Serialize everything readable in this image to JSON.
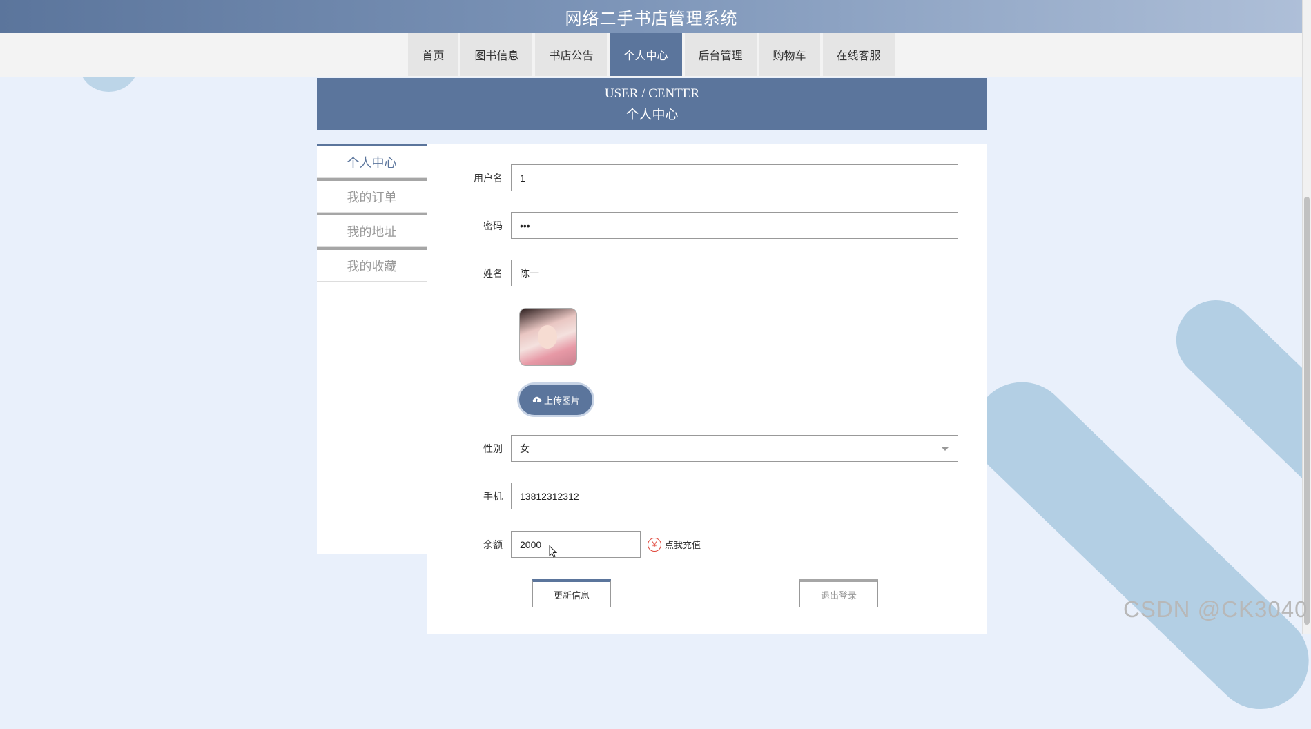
{
  "header": {
    "title": "网络二手书店管理系统"
  },
  "nav": {
    "items": [
      {
        "label": "首页"
      },
      {
        "label": "图书信息"
      },
      {
        "label": "书店公告"
      },
      {
        "label": "个人中心"
      },
      {
        "label": "后台管理"
      },
      {
        "label": "购物车"
      },
      {
        "label": "在线客服"
      }
    ],
    "active": "个人中心"
  },
  "banner": {
    "en": "USER / CENTER",
    "cn": "个人中心"
  },
  "side_menu": {
    "items": [
      {
        "label": "个人中心"
      },
      {
        "label": "我的订单"
      },
      {
        "label": "我的地址"
      },
      {
        "label": "我的收藏"
      }
    ],
    "active": "个人中心"
  },
  "form": {
    "username": {
      "label": "用户名",
      "value": "1"
    },
    "password": {
      "label": "密码",
      "value": "•••"
    },
    "name": {
      "label": "姓名",
      "value": "陈一"
    },
    "upload_label": "上传图片",
    "gender": {
      "label": "性别",
      "value": "女"
    },
    "phone": {
      "label": "手机",
      "value": "13812312312"
    },
    "balance": {
      "label": "余额",
      "value": "2000"
    },
    "recharge_label": "点我充值",
    "recharge_icon": "¥",
    "update_button": "更新信息",
    "logout_button": "退出登录"
  },
  "watermark": "CSDN @CK3040",
  "colors": {
    "primary": "#5b759c",
    "page_bg": "#e9f0fb",
    "accent_red": "#e0463a"
  }
}
